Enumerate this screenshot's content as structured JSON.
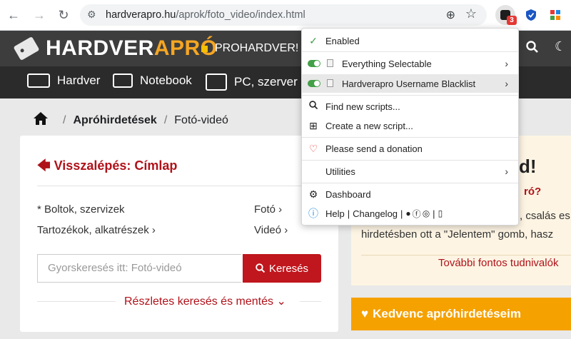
{
  "browser": {
    "url_host": "hardverapro.hu",
    "url_path": "/aprok/foto_video/index.html",
    "ext_badge": "3"
  },
  "header": {
    "logo_left": "HARDVER",
    "logo_right": "APRÓ",
    "prohardver": "PROHARDVER!"
  },
  "nav": {
    "items": [
      "Hardver",
      "Notebook",
      "PC, szerver"
    ]
  },
  "breadcrumb": {
    "items": [
      "Apróhirdetések",
      "Fotó-videó"
    ],
    "sep": "/"
  },
  "left_card": {
    "back_link": "Visszalépés: Címlap",
    "categories": {
      "shops": "* Boltok, szervizek",
      "accessories": "Tartozékok, alkatrészek",
      "photo": "Fotó",
      "video": "Videó"
    },
    "search_placeholder": "Gyorskeresés itt: Fotó-videó",
    "search_button": "Keresés",
    "advanced": "Részletes keresés és mentés"
  },
  "right_card": {
    "title": "d!",
    "subtitle": "ró?",
    "line1": ", csalás es",
    "line2": "hirdetésben ott a \"Jelentem\" gomb, hasz",
    "more": "További fontos tudnivalók"
  },
  "favorites": {
    "label": "Kedvenc apróhirdetéseim"
  },
  "menu": {
    "enabled": "Enabled",
    "scripts": [
      "Everything Selectable",
      "Hardverapro Username Blacklist"
    ],
    "find": "Find new scripts...",
    "create": "Create a new script...",
    "donate": "Please send a donation",
    "utilities": "Utilities",
    "dashboard": "Dashboard",
    "help": "Help",
    "changelog": "Changelog"
  }
}
